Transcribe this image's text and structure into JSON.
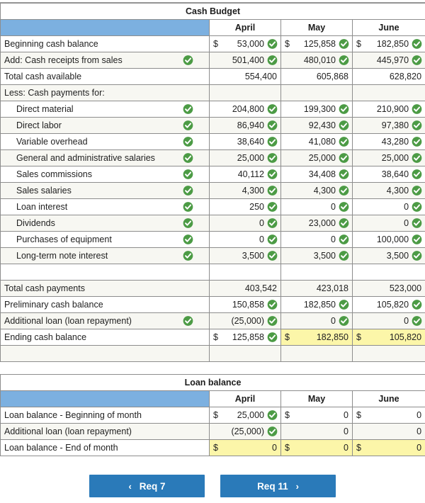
{
  "colors": {
    "header_blue": "#7cb0e0",
    "button_blue": "#2a7ab9",
    "check_green": "#4c9b45",
    "highlight_yellow": "#fcf6a9",
    "alt_row": "#f7f7f2",
    "grid_line": "#8d8d8d"
  },
  "cash_budget": {
    "title": "Cash Budget",
    "columns": [
      "April",
      "May",
      "June"
    ],
    "rows": [
      {
        "label": "Beginning cash balance",
        "indent": false,
        "label_check": false,
        "cells": [
          {
            "dollar": "$",
            "value": "53,000",
            "check": true
          },
          {
            "dollar": "$",
            "value": "125,858",
            "check": true
          },
          {
            "dollar": "$",
            "value": "182,850",
            "check": true
          }
        ]
      },
      {
        "label": "Add: Cash receipts from sales",
        "indent": false,
        "label_check": true,
        "cells": [
          {
            "dollar": "",
            "value": "501,400",
            "check": true
          },
          {
            "dollar": "",
            "value": "480,010",
            "check": true
          },
          {
            "dollar": "",
            "value": "445,970",
            "check": true
          }
        ]
      },
      {
        "label": "Total cash available",
        "indent": false,
        "label_check": false,
        "top_border": true,
        "cells": [
          {
            "dollar": "",
            "value": "554,400",
            "check": false
          },
          {
            "dollar": "",
            "value": "605,868",
            "check": false
          },
          {
            "dollar": "",
            "value": "628,820",
            "check": false
          }
        ]
      },
      {
        "label": "Less: Cash payments for:",
        "indent": false,
        "label_check": false,
        "cells": [
          {
            "dollar": "",
            "value": "",
            "check": false
          },
          {
            "dollar": "",
            "value": "",
            "check": false
          },
          {
            "dollar": "",
            "value": "",
            "check": false
          }
        ]
      },
      {
        "label": "Direct material",
        "indent": true,
        "label_check": true,
        "cells": [
          {
            "dollar": "",
            "value": "204,800",
            "check": true
          },
          {
            "dollar": "",
            "value": "199,300",
            "check": true
          },
          {
            "dollar": "",
            "value": "210,900",
            "check": true
          }
        ]
      },
      {
        "label": "Direct labor",
        "indent": true,
        "label_check": true,
        "cells": [
          {
            "dollar": "",
            "value": "86,940",
            "check": true
          },
          {
            "dollar": "",
            "value": "92,430",
            "check": true
          },
          {
            "dollar": "",
            "value": "97,380",
            "check": true
          }
        ]
      },
      {
        "label": "Variable overhead",
        "indent": true,
        "label_check": true,
        "cells": [
          {
            "dollar": "",
            "value": "38,640",
            "check": true
          },
          {
            "dollar": "",
            "value": "41,080",
            "check": true
          },
          {
            "dollar": "",
            "value": "43,280",
            "check": true
          }
        ]
      },
      {
        "label": "General and administrative salaries",
        "indent": true,
        "label_check": true,
        "cells": [
          {
            "dollar": "",
            "value": "25,000",
            "check": true
          },
          {
            "dollar": "",
            "value": "25,000",
            "check": true
          },
          {
            "dollar": "",
            "value": "25,000",
            "check": true
          }
        ]
      },
      {
        "label": "Sales commissions",
        "indent": true,
        "label_check": true,
        "cells": [
          {
            "dollar": "",
            "value": "40,112",
            "check": true
          },
          {
            "dollar": "",
            "value": "34,408",
            "check": true
          },
          {
            "dollar": "",
            "value": "38,640",
            "check": true
          }
        ]
      },
      {
        "label": "Sales salaries",
        "indent": true,
        "label_check": true,
        "cells": [
          {
            "dollar": "",
            "value": "4,300",
            "check": true
          },
          {
            "dollar": "",
            "value": "4,300",
            "check": true
          },
          {
            "dollar": "",
            "value": "4,300",
            "check": true
          }
        ]
      },
      {
        "label": "Loan interest",
        "indent": true,
        "label_check": true,
        "cells": [
          {
            "dollar": "",
            "value": "250",
            "check": true
          },
          {
            "dollar": "",
            "value": "0",
            "check": true
          },
          {
            "dollar": "",
            "value": "0",
            "check": true
          }
        ]
      },
      {
        "label": "Dividends",
        "indent": true,
        "label_check": true,
        "cells": [
          {
            "dollar": "",
            "value": "0",
            "check": true
          },
          {
            "dollar": "",
            "value": "23,000",
            "check": true
          },
          {
            "dollar": "",
            "value": "0",
            "check": true
          }
        ]
      },
      {
        "label": "Purchases of equipment",
        "indent": true,
        "label_check": true,
        "cells": [
          {
            "dollar": "",
            "value": "0",
            "check": true
          },
          {
            "dollar": "",
            "value": "0",
            "check": true
          },
          {
            "dollar": "",
            "value": "100,000",
            "check": true
          }
        ]
      },
      {
        "label": "Long-term note interest",
        "indent": true,
        "label_check": true,
        "cells": [
          {
            "dollar": "",
            "value": "3,500",
            "check": true
          },
          {
            "dollar": "",
            "value": "3,500",
            "check": true
          },
          {
            "dollar": "",
            "value": "3,500",
            "check": true
          }
        ]
      },
      {
        "label": "",
        "indent": false,
        "label_check": false,
        "cells": [
          {
            "dollar": "",
            "value": "",
            "check": false
          },
          {
            "dollar": "",
            "value": "",
            "check": false
          },
          {
            "dollar": "",
            "value": "",
            "check": false
          }
        ]
      },
      {
        "label": "Total cash payments",
        "indent": false,
        "label_check": false,
        "top_border": true,
        "cells": [
          {
            "dollar": "",
            "value": "403,542",
            "check": false
          },
          {
            "dollar": "",
            "value": "423,018",
            "check": false
          },
          {
            "dollar": "",
            "value": "523,000",
            "check": false
          }
        ]
      },
      {
        "label": "Preliminary cash balance",
        "indent": false,
        "label_check": false,
        "cells": [
          {
            "dollar": "",
            "value": "150,858",
            "check": true
          },
          {
            "dollar": "",
            "value": "182,850",
            "check": true
          },
          {
            "dollar": "",
            "value": "105,820",
            "check": true
          }
        ]
      },
      {
        "label": "Additional loan (loan repayment)",
        "indent": false,
        "label_check": true,
        "cells": [
          {
            "dollar": "",
            "value": "(25,000)",
            "check": true
          },
          {
            "dollar": "",
            "value": "0",
            "check": true
          },
          {
            "dollar": "",
            "value": "0",
            "check": true
          }
        ]
      },
      {
        "label": "Ending cash balance",
        "indent": false,
        "label_check": false,
        "boxed": true,
        "cells": [
          {
            "dollar": "$",
            "value": "125,858",
            "check": true,
            "highlight": false
          },
          {
            "dollar": "$",
            "value": "182,850",
            "check": false,
            "highlight": true
          },
          {
            "dollar": "$",
            "value": "105,820",
            "check": false,
            "highlight": true
          }
        ]
      },
      {
        "label": "",
        "indent": false,
        "label_check": false,
        "cells": [
          {
            "dollar": "",
            "value": "",
            "check": false
          },
          {
            "dollar": "",
            "value": "",
            "check": false
          },
          {
            "dollar": "",
            "value": "",
            "check": false
          }
        ]
      }
    ]
  },
  "loan_balance": {
    "title": "Loan balance",
    "columns": [
      "April",
      "May",
      "June"
    ],
    "rows": [
      {
        "label": "Loan balance - Beginning of month",
        "label_check": false,
        "cells": [
          {
            "dollar": "$",
            "value": "25,000",
            "check": true
          },
          {
            "dollar": "$",
            "value": "0",
            "check": false
          },
          {
            "dollar": "$",
            "value": "0",
            "check": false
          }
        ]
      },
      {
        "label": "Additional loan (loan repayment)",
        "label_check": false,
        "cells": [
          {
            "dollar": "",
            "value": "(25,000)",
            "check": true
          },
          {
            "dollar": "",
            "value": "0",
            "check": false
          },
          {
            "dollar": "",
            "value": "0",
            "check": false
          }
        ]
      },
      {
        "label": "Loan balance - End of month",
        "label_check": false,
        "boxed": true,
        "cells": [
          {
            "dollar": "$",
            "value": "0",
            "check": false,
            "highlight": true
          },
          {
            "dollar": "$",
            "value": "0",
            "check": false,
            "highlight": true
          },
          {
            "dollar": "$",
            "value": "0",
            "check": false,
            "highlight": true
          }
        ]
      }
    ]
  },
  "nav": {
    "prev": {
      "label": "Req 7",
      "arrow": "‹"
    },
    "next": {
      "label": "Req 11",
      "arrow": "›"
    }
  }
}
